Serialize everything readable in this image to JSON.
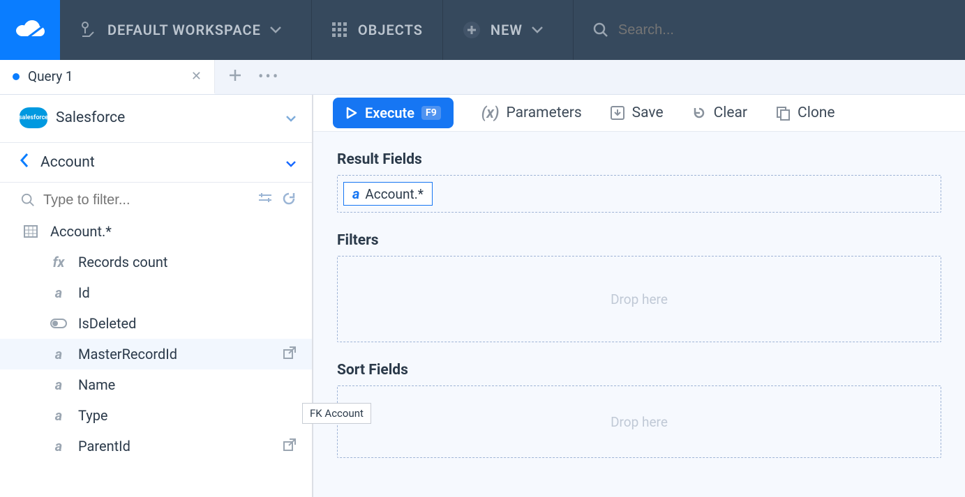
{
  "topnav": {
    "workspace_label": "DEFAULT WORKSPACE",
    "objects_label": "OBJECTS",
    "new_label": "NEW",
    "search_placeholder": "Search..."
  },
  "tabs": {
    "active": {
      "label": "Query 1"
    }
  },
  "sidebar": {
    "connection_name": "Salesforce",
    "object_name": "Account",
    "filter_placeholder": "Type to filter...",
    "fields": [
      {
        "icon": "table",
        "label": "Account.*",
        "indent": false
      },
      {
        "icon": "fx",
        "label": "Records count",
        "indent": true
      },
      {
        "icon": "a",
        "label": "Id",
        "indent": true
      },
      {
        "icon": "toggle",
        "label": "IsDeleted",
        "indent": true
      },
      {
        "icon": "a",
        "label": "MasterRecordId",
        "indent": true,
        "fk": true,
        "highlight": true
      },
      {
        "icon": "a",
        "label": "Name",
        "indent": true
      },
      {
        "icon": "a",
        "label": "Type",
        "indent": true
      },
      {
        "icon": "a",
        "label": "ParentId",
        "indent": true,
        "fk": true
      }
    ],
    "tooltip_text": "FK Account"
  },
  "toolbar": {
    "execute_label": "Execute",
    "execute_shortcut": "F9",
    "parameters_label": "Parameters",
    "save_label": "Save",
    "clear_label": "Clear",
    "clone_label": "Clone"
  },
  "builder": {
    "result_fields_label": "Result Fields",
    "filters_label": "Filters",
    "sort_fields_label": "Sort Fields",
    "drop_placeholder": "Drop here",
    "result_chip_label": "Account.*"
  }
}
